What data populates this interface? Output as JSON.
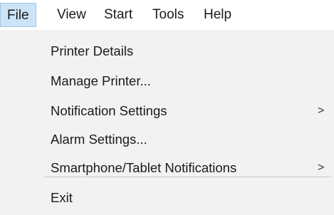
{
  "menubar": {
    "items": [
      {
        "label": "File",
        "active": true
      },
      {
        "label": "View",
        "active": false
      },
      {
        "label": "Start",
        "active": false
      },
      {
        "label": "Tools",
        "active": false
      },
      {
        "label": "Help",
        "active": false
      }
    ]
  },
  "file_menu": {
    "items": [
      {
        "label": "Printer Details",
        "submenu": false
      },
      {
        "label": "Manage Printer...",
        "submenu": false
      },
      {
        "label": "Notification Settings",
        "submenu": true,
        "arrow": ">"
      },
      {
        "label": "Alarm Settings...",
        "submenu": false
      },
      {
        "label": "Smartphone/Tablet Notifications",
        "submenu": true,
        "arrow": ">"
      }
    ],
    "exit_label": "Exit"
  },
  "colors": {
    "active_highlight": "#cce4f7",
    "active_border": "#99c9ef",
    "menu_background": "#f2f2f2"
  }
}
